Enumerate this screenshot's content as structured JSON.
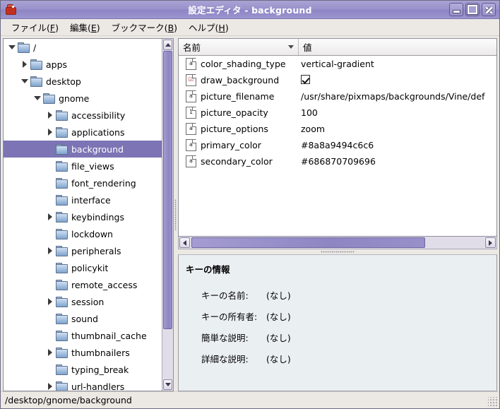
{
  "window": {
    "title": "設定エディタ - background",
    "app_icon": "gconf-editor-icon",
    "buttons": {
      "minimize": "minimize-button",
      "maximize": "maximize-button",
      "close": "close-button"
    }
  },
  "menubar": [
    {
      "label": "ファイル(",
      "mnemonic": "F",
      "tail": ")"
    },
    {
      "label": "編集(",
      "mnemonic": "E",
      "tail": ")"
    },
    {
      "label": "ブックマーク(",
      "mnemonic": "B",
      "tail": ")"
    },
    {
      "label": "ヘルプ(",
      "mnemonic": "H",
      "tail": ")"
    }
  ],
  "tree": {
    "items": [
      {
        "label": "/",
        "depth": 0,
        "expander": "open",
        "selected": false
      },
      {
        "label": "apps",
        "depth": 1,
        "expander": "closed",
        "selected": false
      },
      {
        "label": "desktop",
        "depth": 1,
        "expander": "open",
        "selected": false
      },
      {
        "label": "gnome",
        "depth": 2,
        "expander": "open",
        "selected": false
      },
      {
        "label": "accessibility",
        "depth": 3,
        "expander": "closed",
        "selected": false
      },
      {
        "label": "applications",
        "depth": 3,
        "expander": "closed",
        "selected": false
      },
      {
        "label": "background",
        "depth": 3,
        "expander": "none",
        "selected": true
      },
      {
        "label": "file_views",
        "depth": 3,
        "expander": "none",
        "selected": false
      },
      {
        "label": "font_rendering",
        "depth": 3,
        "expander": "none",
        "selected": false
      },
      {
        "label": "interface",
        "depth": 3,
        "expander": "none",
        "selected": false
      },
      {
        "label": "keybindings",
        "depth": 3,
        "expander": "closed",
        "selected": false
      },
      {
        "label": "lockdown",
        "depth": 3,
        "expander": "none",
        "selected": false
      },
      {
        "label": "peripherals",
        "depth": 3,
        "expander": "closed",
        "selected": false
      },
      {
        "label": "policykit",
        "depth": 3,
        "expander": "none",
        "selected": false
      },
      {
        "label": "remote_access",
        "depth": 3,
        "expander": "none",
        "selected": false
      },
      {
        "label": "session",
        "depth": 3,
        "expander": "closed",
        "selected": false
      },
      {
        "label": "sound",
        "depth": 3,
        "expander": "none",
        "selected": false
      },
      {
        "label": "thumbnail_cache",
        "depth": 3,
        "expander": "none",
        "selected": false
      },
      {
        "label": "thumbnailers",
        "depth": 3,
        "expander": "closed",
        "selected": false
      },
      {
        "label": "typing_break",
        "depth": 3,
        "expander": "none",
        "selected": false
      },
      {
        "label": "url-handlers",
        "depth": 3,
        "expander": "closed",
        "selected": false
      }
    ]
  },
  "table": {
    "columns": [
      {
        "label": "名前",
        "sort_icon": "chevron-down-icon"
      },
      {
        "label": "値"
      }
    ],
    "rows": [
      {
        "icon": "string-key-icon",
        "icon_glyph": "a",
        "name": "color_shading_type",
        "value": "vertical-gradient",
        "type": "string"
      },
      {
        "icon": "boolean-key-icon",
        "icon_glyph": "☑",
        "name": "draw_background",
        "value": "",
        "type": "boolean",
        "checked": true
      },
      {
        "icon": "string-key-icon",
        "icon_glyph": "a",
        "name": "picture_filename",
        "value": "/usr/share/pixmaps/backgrounds/Vine/def",
        "type": "string"
      },
      {
        "icon": "integer-key-icon",
        "icon_glyph": "1",
        "name": "picture_opacity",
        "value": "100",
        "type": "integer"
      },
      {
        "icon": "string-key-icon",
        "icon_glyph": "a",
        "name": "picture_options",
        "value": "zoom",
        "type": "string"
      },
      {
        "icon": "string-key-icon",
        "icon_glyph": "a",
        "name": "primary_color",
        "value": "#8a8a9494c6c6",
        "type": "string"
      },
      {
        "icon": "string-key-icon",
        "icon_glyph": "a",
        "name": "secondary_color",
        "value": "#686870709696",
        "type": "string"
      }
    ]
  },
  "info_panel": {
    "title": "キーの情報",
    "rows": [
      {
        "label": "キーの名前:",
        "value": "(なし)"
      },
      {
        "label": "キーの所有者:",
        "value": "(なし)"
      },
      {
        "label": "簡単な説明:",
        "value": "(なし)"
      },
      {
        "label": "詳細な説明:",
        "value": "(なし)"
      }
    ]
  },
  "statusbar": {
    "path": "/desktop/gnome/background"
  },
  "colors": {
    "titlebar": "#9a93cc",
    "selection": "#7c74b4",
    "scrollbar_thumb": "#8e86c2",
    "info_background": "#eaeff2",
    "chrome": "#ece9e4"
  }
}
